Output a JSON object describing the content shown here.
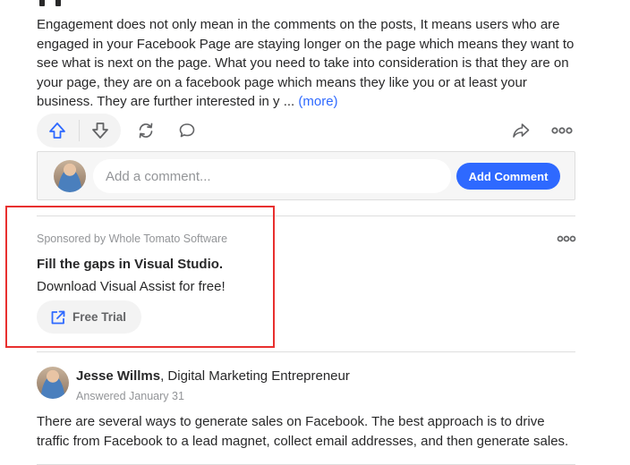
{
  "post": {
    "body": "Engagement does not only mean in the comments on the posts, It means users who are engaged in your Facebook Page are staying longer on the page which means they want to see what is next on the page. What you need to take into consideration is that they are on your page, they are on a facebook page which means they like you or at least your business. They are further interested in y ...",
    "more_label": "(more)"
  },
  "actions": {
    "upvote_icon": "arrow-up-outline",
    "downvote_icon": "arrow-down-outline",
    "reshare_icon": "refresh-cycle",
    "comment_icon": "speech-bubble",
    "share_icon": "share-arrow",
    "more_icon": "three-dots"
  },
  "comment_composer": {
    "placeholder": "Add a comment...",
    "value": "",
    "submit_label": "Add Comment"
  },
  "ad": {
    "sponsor": "Sponsored by Whole Tomato Software",
    "title": "Fill the gaps in Visual Studio.",
    "description": "Download Visual Assist for free!",
    "cta_label": "Free Trial",
    "cta_icon": "external-link"
  },
  "answer": {
    "author_name": "Jesse Willms",
    "author_credential": ", Digital Marketing Entrepreneur",
    "date": "Answered January 31",
    "body": "There are several ways to generate sales on Facebook. The best approach is to drive traffic from Facebook to a lead magnet, collect email addresses, and then generate sales."
  },
  "colors": {
    "accent": "#2e69ff",
    "highlight_border": "#e8302f",
    "text_primary": "#282829",
    "text_secondary": "#939598"
  }
}
